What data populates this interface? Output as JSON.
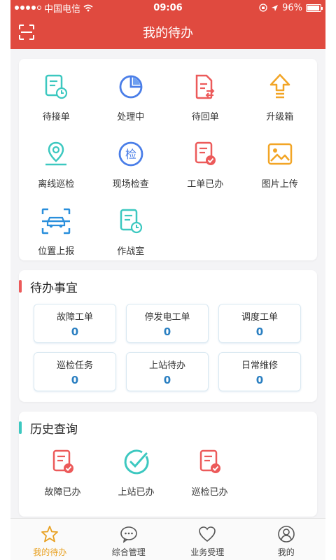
{
  "status_bar": {
    "carrier": "中国电信",
    "time": "09:06",
    "battery_text": "96%",
    "battery_level": 0.96
  },
  "header": {
    "title": "我的待办",
    "scan_icon": "scan-icon"
  },
  "shortcuts": [
    {
      "label": "待接单",
      "icon": "pending-receive-icon",
      "color": "#3cc8c0"
    },
    {
      "label": "处理中",
      "icon": "processing-pie-icon",
      "color": "#4a7ee8"
    },
    {
      "label": "待回单",
      "icon": "return-document-icon",
      "color": "#ec5a5a"
    },
    {
      "label": "升级箱",
      "icon": "upgrade-arrow-icon",
      "color": "#f2a526"
    },
    {
      "label": "离线巡检",
      "icon": "location-pin-icon",
      "color": "#3cc8c0"
    },
    {
      "label": "现场检查",
      "icon": "inspect-badge-icon",
      "color": "#4a7ee8"
    },
    {
      "label": "工单已办",
      "icon": "done-document-icon",
      "color": "#ec5a5a"
    },
    {
      "label": "图片上传",
      "icon": "image-upload-icon",
      "color": "#f2a526"
    },
    {
      "label": "位置上报",
      "icon": "vehicle-scan-icon",
      "color": "#2a8fdc"
    },
    {
      "label": "作战室",
      "icon": "war-room-icon",
      "color": "#3cc8c0"
    }
  ],
  "todo_section": {
    "title": "待办事宜",
    "accent": "#ec5a5a",
    "items": [
      {
        "label": "故障工单",
        "value": "0"
      },
      {
        "label": "停发电工单",
        "value": "0"
      },
      {
        "label": "调度工单",
        "value": "0"
      },
      {
        "label": "巡检任务",
        "value": "0"
      },
      {
        "label": "上站待办",
        "value": "0"
      },
      {
        "label": "日常维修",
        "value": "0"
      }
    ]
  },
  "history_section": {
    "title": "历史查询",
    "accent": "#3cc8c0",
    "items": [
      {
        "label": "故障已办",
        "icon": "fault-done-icon",
        "color": "#ec5a5a"
      },
      {
        "label": "上站已办",
        "icon": "check-circle-icon",
        "color": "#3cc8c0"
      },
      {
        "label": "巡检已办",
        "icon": "inspection-done-icon",
        "color": "#ec5a5a"
      }
    ]
  },
  "tabbar": {
    "active_color": "#e8a020",
    "tabs": [
      {
        "label": "我的待办",
        "icon": "star-icon",
        "active": true
      },
      {
        "label": "综合管理",
        "icon": "chat-bubble-icon",
        "active": false
      },
      {
        "label": "业务受理",
        "icon": "heart-icon",
        "active": false
      },
      {
        "label": "我的",
        "icon": "user-icon",
        "active": false
      }
    ]
  }
}
